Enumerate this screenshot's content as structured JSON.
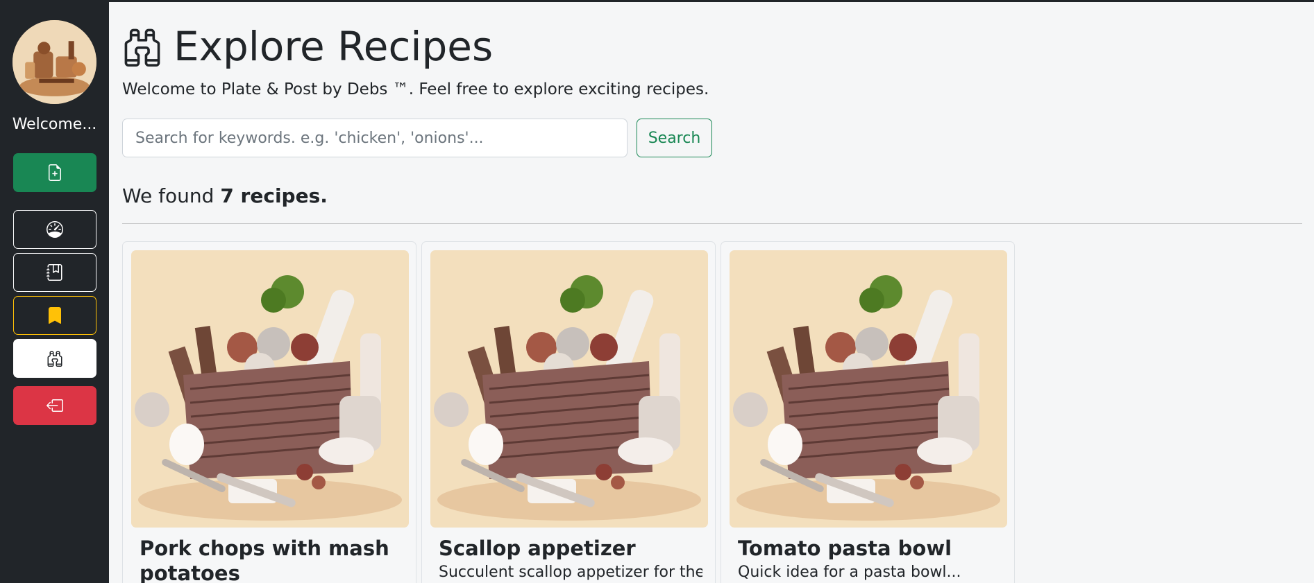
{
  "sidebar": {
    "welcome": "Welcome...",
    "buttons": [
      {
        "name": "new-recipe",
        "icon": "file-plus-icon",
        "color": "#198754"
      },
      {
        "name": "dashboard",
        "icon": "speedometer-icon",
        "color": "#f8f9fa"
      },
      {
        "name": "my-recipes",
        "icon": "journal-icon",
        "color": "#f8f9fa"
      },
      {
        "name": "saved",
        "icon": "bookmark-heart-icon",
        "color": "#ffc107"
      },
      {
        "name": "explore",
        "icon": "binoculars-icon",
        "color": "#ffffff"
      },
      {
        "name": "logout",
        "icon": "box-arrow-left-icon",
        "color": "#dc3545"
      }
    ]
  },
  "header": {
    "title": "Explore Recipes",
    "subtitle": "Welcome to Plate & Post by Debs ™. Feel free to explore exciting recipes."
  },
  "search": {
    "placeholder": "Search for keywords. e.g. 'chicken', 'onions'...",
    "value": "",
    "button_label": "Search"
  },
  "results": {
    "prefix": "We found ",
    "count_text": "7 recipes."
  },
  "recipes": [
    {
      "title": "Pork chops with mash potatoes",
      "description": ""
    },
    {
      "title": "Scallop appetizer",
      "description": "Succulent scallop appetizer for the"
    },
    {
      "title": "Tomato pasta bowl",
      "description": "Quick idea for a pasta bowl..."
    }
  ],
  "colors": {
    "sidebar_bg": "#212529",
    "page_bg": "#f5f6f7",
    "success": "#198754",
    "warning": "#ffc107",
    "danger": "#dc3545"
  }
}
